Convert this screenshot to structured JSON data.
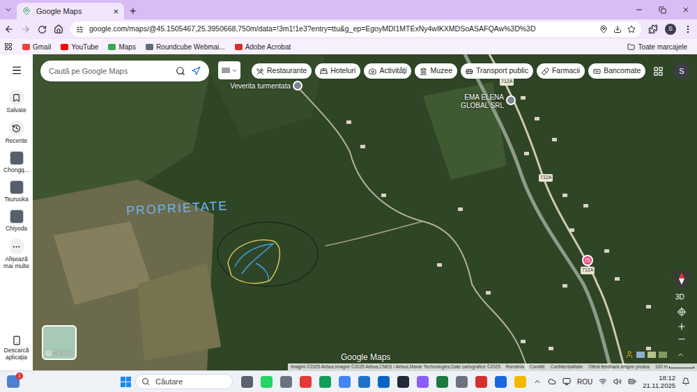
{
  "browser": {
    "tab": {
      "label": "Google Maps",
      "selected": true
    },
    "close_tab": "×",
    "new_tab": "+",
    "url": "google.com/maps/@45.1505467,25.3950668,750m/data=!3m1!1e3?entry=ttu&g_ep=EgoyMDI1MTExNy4wIKXMDSoASAFQAw%3D%3D",
    "profile": "S"
  },
  "bookmarks": {
    "items": [
      "Gmail",
      "YouTube",
      "Maps",
      "Roundcube Webmai...",
      "Adobe Acrobat"
    ],
    "all": "Toate marcajele"
  },
  "sidebar": {
    "items": [
      {
        "label": "Salvate",
        "kind": "icon"
      },
      {
        "label": "Recente",
        "kind": "icon"
      },
      {
        "label": "Chongq...",
        "kind": "place"
      },
      {
        "label": "Tsuruoka",
        "kind": "place"
      },
      {
        "label": "Chiyoda",
        "kind": "place"
      },
      {
        "label": "Afișează mai multe",
        "kind": "icon"
      }
    ],
    "download": "Descarcă aplicația"
  },
  "map": {
    "search_placeholder": "Caută pe Google Maps",
    "chips": [
      "Restaurante",
      "Hoteluri",
      "Activități",
      "Muzee",
      "Transport public",
      "Farmacii",
      "Bancomate"
    ],
    "account": "S",
    "places": [
      "Veverita turmentata",
      "EMA ELENA GLOBAL SRL"
    ],
    "road_labels": [
      "712A",
      "712A",
      "712A"
    ],
    "annotation": "PROPRIETATE",
    "logo": "Google Maps",
    "layers": "Straturi",
    "view_3d": "3D",
    "attribution": [
      "Imagini ©2025 Airbus,Imagini ©2025 Airbus,CNES / Airbus,Maxar Technologies,Date cartografice ©2025",
      "România",
      "Condiții",
      "Confidențialitate",
      "Oferă feedback despre produs"
    ],
    "scale": "100 m"
  },
  "taskbar": {
    "notification": "1",
    "search": "Căutare",
    "language": "ROU",
    "time": "18:12",
    "date": "21.11.2025"
  }
}
